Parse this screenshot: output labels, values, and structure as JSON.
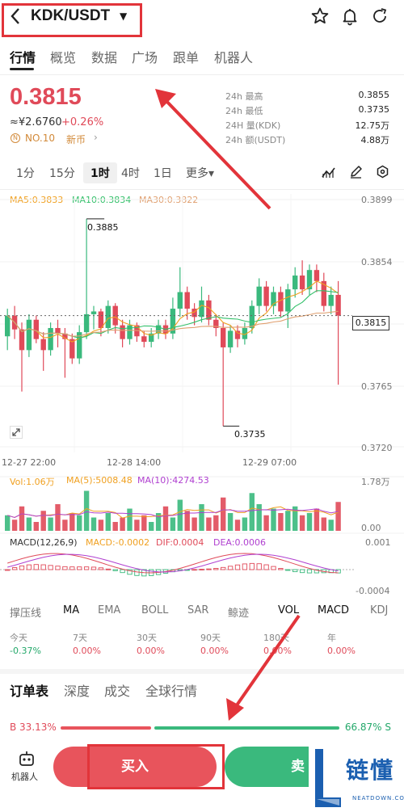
{
  "header": {
    "back_icon": "chevron-left-icon",
    "pair": "KDK/USDT",
    "caret_icon": "caret-down-icon",
    "icons": [
      "star-icon",
      "bell-icon",
      "refresh-icon"
    ]
  },
  "tabs": [
    "行情",
    "概览",
    "数据",
    "广场",
    "跟单",
    "机器人"
  ],
  "ticker": {
    "price": "0.3815",
    "cny": "≈¥2.6760",
    "change": "+0.26%",
    "rank": "NO.10",
    "rank_badge": "N",
    "new_coin": "新币",
    "new_coin_arrow": "›",
    "stats": [
      {
        "label": "24h  最高",
        "value": "0.3855"
      },
      {
        "label": "24h  最低",
        "value": "0.3735"
      },
      {
        "label": "24H  量(KDK)",
        "value": "12.75万"
      },
      {
        "label": "24h  额(USDT)",
        "value": "4.88万"
      }
    ]
  },
  "intervals": [
    "1分",
    "15分",
    "1时",
    "4时",
    "1日",
    "更多▾"
  ],
  "interval_active": "1时",
  "chart_icons": [
    "indicator-icon",
    "draw-icon",
    "settings-icon"
  ],
  "ma_legend": {
    "ma5": "MA5:0.3833",
    "ma10": "MA10:0.3834",
    "ma30": "MA30:0.3822"
  },
  "price_axis": [
    "0.3899",
    "0.3854",
    "0.3765",
    "0.3720"
  ],
  "callouts": {
    "high": "0.3885",
    "low": "0.3735"
  },
  "current_price_tag": "0.3815",
  "time_axis": [
    "12-27 22:00",
    "12-28 14:00",
    "12-29 07:00"
  ],
  "vol_legend": {
    "vol": "Vol:1.06万",
    "ma5": "MA(5):5008.48",
    "ma10": "MA(10):4274.53"
  },
  "vol_axis": [
    "1.78万",
    "0.00"
  ],
  "macd_legend": {
    "params": "MACD(12,26,9)",
    "macd": "MACD:-0.0002",
    "dif": "DIF:0.0004",
    "dea": "DEA:0.0006"
  },
  "macd_axis": [
    "0.001",
    "-0.0004"
  ],
  "indicators": [
    "撑压线",
    "MA",
    "EMA",
    "BOLL",
    "SAR",
    "鲸迹",
    "VOL",
    "MACD",
    "KDJ"
  ],
  "indicators_active": [
    "MA",
    "VOL",
    "MACD"
  ],
  "periods": [
    {
      "label": "今天",
      "value": "-0.37%",
      "up": false
    },
    {
      "label": "7天",
      "value": "0.00%",
      "up": true
    },
    {
      "label": "30天",
      "value": "0.00%",
      "up": true
    },
    {
      "label": "90天",
      "value": "0.00%",
      "up": true
    },
    {
      "label": "180天",
      "value": "0.00%",
      "up": true
    },
    {
      "label": "年",
      "value": "0.00%",
      "up": true
    }
  ],
  "orderbook_tabs": [
    "订单表",
    "深度",
    "成交",
    "全球行情"
  ],
  "ratio": {
    "buy": "B 33.13%",
    "sell": "66.87% S",
    "buy_fraction": 0.3313
  },
  "bottom": {
    "robot_label": "机器人",
    "robot_icon": "robot-icon",
    "buy": "买入",
    "sell": "卖"
  },
  "watermark": {
    "text": "链懂",
    "sub": "NEATDOWN.COM"
  },
  "colors": {
    "up": "#e04a59",
    "down": "#3ab97d",
    "ma5": "#f0a020",
    "ma10": "#33c06a",
    "ma30": "#e0a070",
    "vol_ma10": "#b040d0",
    "annotation": "#e2343a"
  },
  "chart_data": {
    "type": "candlestick",
    "title": "",
    "interval": "1时",
    "ylim": [
      0.372,
      0.3899
    ],
    "y_ticks": [
      0.3899,
      0.3854,
      0.3765,
      0.372
    ],
    "x_ticks": [
      "12-27 22:00",
      "12-28 14:00",
      "12-29 07:00"
    ],
    "high": 0.3885,
    "low": 0.3735,
    "last": 0.3815,
    "candles": [
      [
        0.38,
        0.3815,
        0.379,
        0.382
      ],
      [
        0.3815,
        0.3805,
        0.3798,
        0.3822
      ],
      [
        0.3805,
        0.379,
        0.376,
        0.381
      ],
      [
        0.379,
        0.3812,
        0.3785,
        0.3816
      ],
      [
        0.3812,
        0.3798,
        0.3795,
        0.3815
      ],
      [
        0.3798,
        0.379,
        0.3775,
        0.3803
      ],
      [
        0.379,
        0.3806,
        0.3786,
        0.381
      ],
      [
        0.3806,
        0.3802,
        0.3792,
        0.3812
      ],
      [
        0.3802,
        0.3798,
        0.377,
        0.3806
      ],
      [
        0.3798,
        0.3784,
        0.378,
        0.3802
      ],
      [
        0.3784,
        0.3803,
        0.378,
        0.3808
      ],
      [
        0.3803,
        0.3816,
        0.3798,
        0.3885
      ],
      [
        0.3816,
        0.3818,
        0.3805,
        0.3822
      ],
      [
        0.3818,
        0.3806,
        0.38,
        0.382
      ],
      [
        0.3806,
        0.3822,
        0.3802,
        0.3826
      ],
      [
        0.3822,
        0.3808,
        0.3802,
        0.3824
      ],
      [
        0.3808,
        0.3798,
        0.3792,
        0.3812
      ],
      [
        0.3798,
        0.3808,
        0.3794,
        0.3812
      ],
      [
        0.3808,
        0.38,
        0.3796,
        0.381
      ],
      [
        0.38,
        0.3796,
        0.3792,
        0.3804
      ],
      [
        0.3796,
        0.3802,
        0.3792,
        0.3806
      ],
      [
        0.3802,
        0.3808,
        0.3798,
        0.3812
      ],
      [
        0.3808,
        0.3802,
        0.3798,
        0.3812
      ],
      [
        0.3802,
        0.382,
        0.3798,
        0.3828
      ],
      [
        0.382,
        0.3832,
        0.3814,
        0.385
      ],
      [
        0.3832,
        0.382,
        0.3812,
        0.3836
      ],
      [
        0.382,
        0.3814,
        0.3808,
        0.3824
      ],
      [
        0.3814,
        0.3826,
        0.381,
        0.3836
      ],
      [
        0.3826,
        0.3812,
        0.3808,
        0.383
      ],
      [
        0.3812,
        0.3806,
        0.38,
        0.3816
      ],
      [
        0.3806,
        0.3792,
        0.3735,
        0.381
      ],
      [
        0.3792,
        0.3804,
        0.3788,
        0.3808
      ],
      [
        0.3804,
        0.3798,
        0.3792,
        0.3808
      ],
      [
        0.3798,
        0.3806,
        0.3794,
        0.381
      ],
      [
        0.3806,
        0.3822,
        0.3802,
        0.3826
      ],
      [
        0.3822,
        0.3836,
        0.3816,
        0.3842
      ],
      [
        0.3836,
        0.3822,
        0.3818,
        0.384
      ],
      [
        0.3822,
        0.3832,
        0.3816,
        0.3836
      ],
      [
        0.3832,
        0.3818,
        0.3814,
        0.3836
      ],
      [
        0.3818,
        0.3834,
        0.3806,
        0.3838
      ],
      [
        0.3834,
        0.3844,
        0.3828,
        0.385
      ],
      [
        0.3844,
        0.3834,
        0.383,
        0.3855
      ],
      [
        0.3834,
        0.3848,
        0.383,
        0.3852
      ],
      [
        0.3848,
        0.384,
        0.3832,
        0.3852
      ],
      [
        0.384,
        0.3822,
        0.3818,
        0.3846
      ],
      [
        0.3822,
        0.383,
        0.3816,
        0.3836
      ],
      [
        0.383,
        0.3815,
        0.3765,
        0.384
      ]
    ],
    "candle_format": [
      "open",
      "close",
      "low",
      "high"
    ]
  }
}
